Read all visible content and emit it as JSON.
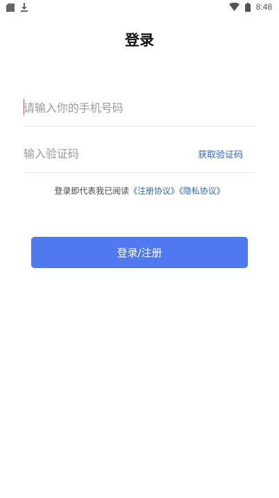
{
  "status_bar": {
    "time": "8:48",
    "left_icons": [
      "sd-card-icon",
      "download-icon"
    ],
    "right_icons": [
      "wifi-icon",
      "battery-icon"
    ]
  },
  "page": {
    "title": "登录"
  },
  "form": {
    "phone_placeholder": "请输入你的手机号码",
    "phone_value": "",
    "code_placeholder": "输入验证码",
    "code_value": "",
    "get_code_label": "获取验证码"
  },
  "agreement": {
    "prefix": "登录即代表我已阅读",
    "register_link": "《注册协议》",
    "privacy_link": "《隐私协议》"
  },
  "submit": {
    "label": "登录/注册"
  },
  "colors": {
    "accent": "#5079f0",
    "link": "#2b63c7",
    "caret": "#e0437a"
  }
}
